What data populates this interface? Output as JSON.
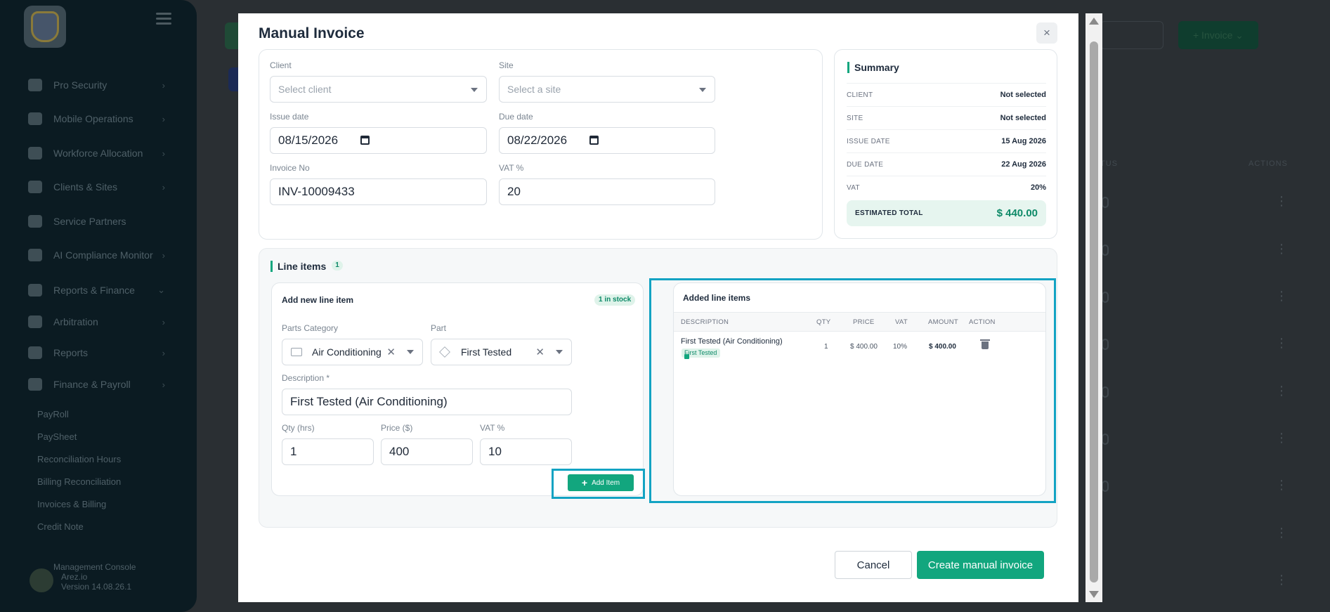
{
  "sidebar": {
    "items": [
      {
        "label": "Pro Security",
        "icon": "person-icon",
        "chevron": "›"
      },
      {
        "label": "Mobile Operations",
        "icon": "car-icon",
        "chevron": "›"
      },
      {
        "label": "Workforce Allocation",
        "icon": "list-icon",
        "chevron": "›"
      },
      {
        "label": "Clients & Sites",
        "icon": "handshake-icon",
        "chevron": "›"
      },
      {
        "label": "Service Partners",
        "icon": "handshake-icon",
        "chevron": ""
      },
      {
        "label": "AI Compliance Monitor",
        "icon": "robot-icon",
        "chevron": "›"
      },
      {
        "label": "Reports & Finance",
        "icon": "chart-icon",
        "chevron": "⌄"
      },
      {
        "label": "Arbitration",
        "icon": "gavel-icon",
        "chevron": "›"
      },
      {
        "label": "Reports",
        "icon": "user-check-icon",
        "chevron": "›"
      },
      {
        "label": "Finance & Payroll",
        "icon": "bar-chart-icon",
        "chevron": "›"
      }
    ],
    "subitems": [
      "PayRoll",
      "PaySheet",
      "Reconciliation Hours",
      "Billing Reconciliation",
      "Invoices & Billing",
      "Credit Note"
    ],
    "footer": {
      "title": "Management Console",
      "org": "Arez.io",
      "version": "Version 14.08.26.1"
    }
  },
  "background": {
    "invoice_button": "+ Invoice ⌄",
    "status_header": "TUS",
    "actions_header": "ACTIONS"
  },
  "modal": {
    "title": "Manual Invoice",
    "close": "×",
    "form": {
      "client": {
        "label": "Client",
        "placeholder": "Select client"
      },
      "site": {
        "label": "Site",
        "placeholder": "Select a site"
      },
      "issue_date": {
        "label": "Issue date",
        "value": "08/15/2026"
      },
      "due_date": {
        "label": "Due date",
        "value": "08/22/2026"
      },
      "invoice_no": {
        "label": "Invoice No",
        "value": "INV-10009433"
      },
      "vat": {
        "label": "VAT %",
        "value": "20"
      }
    },
    "summary": {
      "title": "Summary",
      "rows": [
        {
          "key": "CLIENT",
          "value": "Not selected"
        },
        {
          "key": "SITE",
          "value": "Not selected"
        },
        {
          "key": "ISSUE DATE",
          "value": "15 Aug 2026"
        },
        {
          "key": "DUE DATE",
          "value": "22 Aug 2026"
        },
        {
          "key": "VAT",
          "value": "20%"
        }
      ],
      "total_label": "ESTIMATED TOTAL",
      "total_value": "$ 440.00"
    },
    "line_items": {
      "title": "Line items",
      "count": "1",
      "add": {
        "title": "Add new line item",
        "stock": "1 in stock",
        "parts_category_label": "Parts Category",
        "parts_category_value": "Air Conditioning",
        "part_label": "Part",
        "part_value": "First Tested",
        "description_label": "Description *",
        "description_value": "First Tested (Air Conditioning)",
        "qty_label": "Qty (hrs)",
        "qty_value": "1",
        "price_label": "Price ($)",
        "price_value": "400",
        "vat_label": "VAT %",
        "vat_value": "10",
        "add_button": "Add Item"
      },
      "added": {
        "title": "Added line items",
        "columns": [
          "DESCRIPTION",
          "QTY",
          "PRICE",
          "VAT",
          "AMOUNT",
          "ACTION"
        ],
        "rows": [
          {
            "description": "First Tested (Air Conditioning)",
            "tag": "First Tested",
            "qty": "1",
            "price": "$ 400.00",
            "vat": "10%",
            "amount": "$ 400.00"
          }
        ]
      }
    },
    "cancel": "Cancel",
    "create": "Create manual invoice"
  },
  "colors": {
    "accent": "#12a67e",
    "highlight": "#13a3c3",
    "sidebar": "#0b1b22"
  }
}
